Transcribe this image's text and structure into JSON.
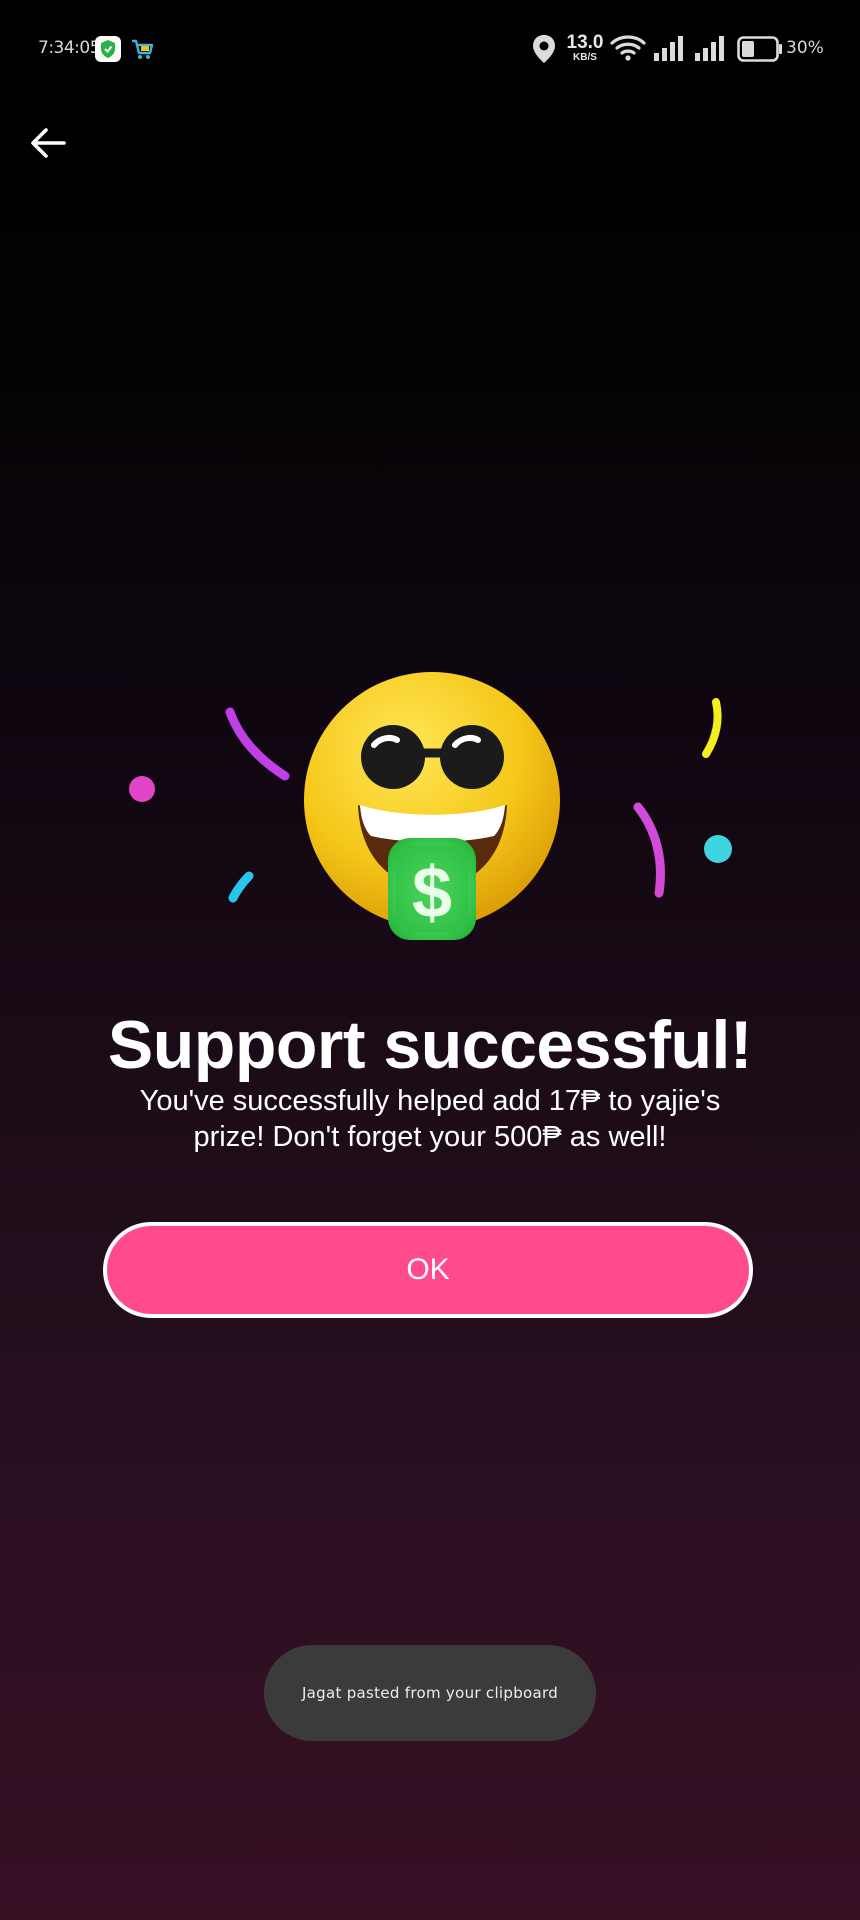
{
  "status_bar": {
    "time": "7:34:05",
    "net_speed_value": "13.0",
    "net_speed_unit": "KB/S",
    "battery_percent": "30%",
    "icons": [
      "shield-app-icon",
      "cart-app-icon",
      "location-icon",
      "wifi-icon",
      "signal-icon",
      "signal-icon",
      "battery-icon"
    ]
  },
  "header": {
    "back_icon": "arrow-left-icon"
  },
  "hero": {
    "emoji": "money-mouth-sunglasses-emoji",
    "confetti_colors": [
      "#e45ce0",
      "#c040e8",
      "#2fc8f0",
      "#f2ee20",
      "#40d8e0"
    ]
  },
  "main": {
    "title": "Support successful!",
    "message": "You've successfully helped add 17₱ to yajie's prize! Don't forget your 500₱ as well!",
    "ok_label": "OK"
  },
  "toast": {
    "text": "Jagat pasted from your clipboard"
  },
  "colors": {
    "accent": "#ff4b8c",
    "toast_bg": "#3b3b3b"
  }
}
